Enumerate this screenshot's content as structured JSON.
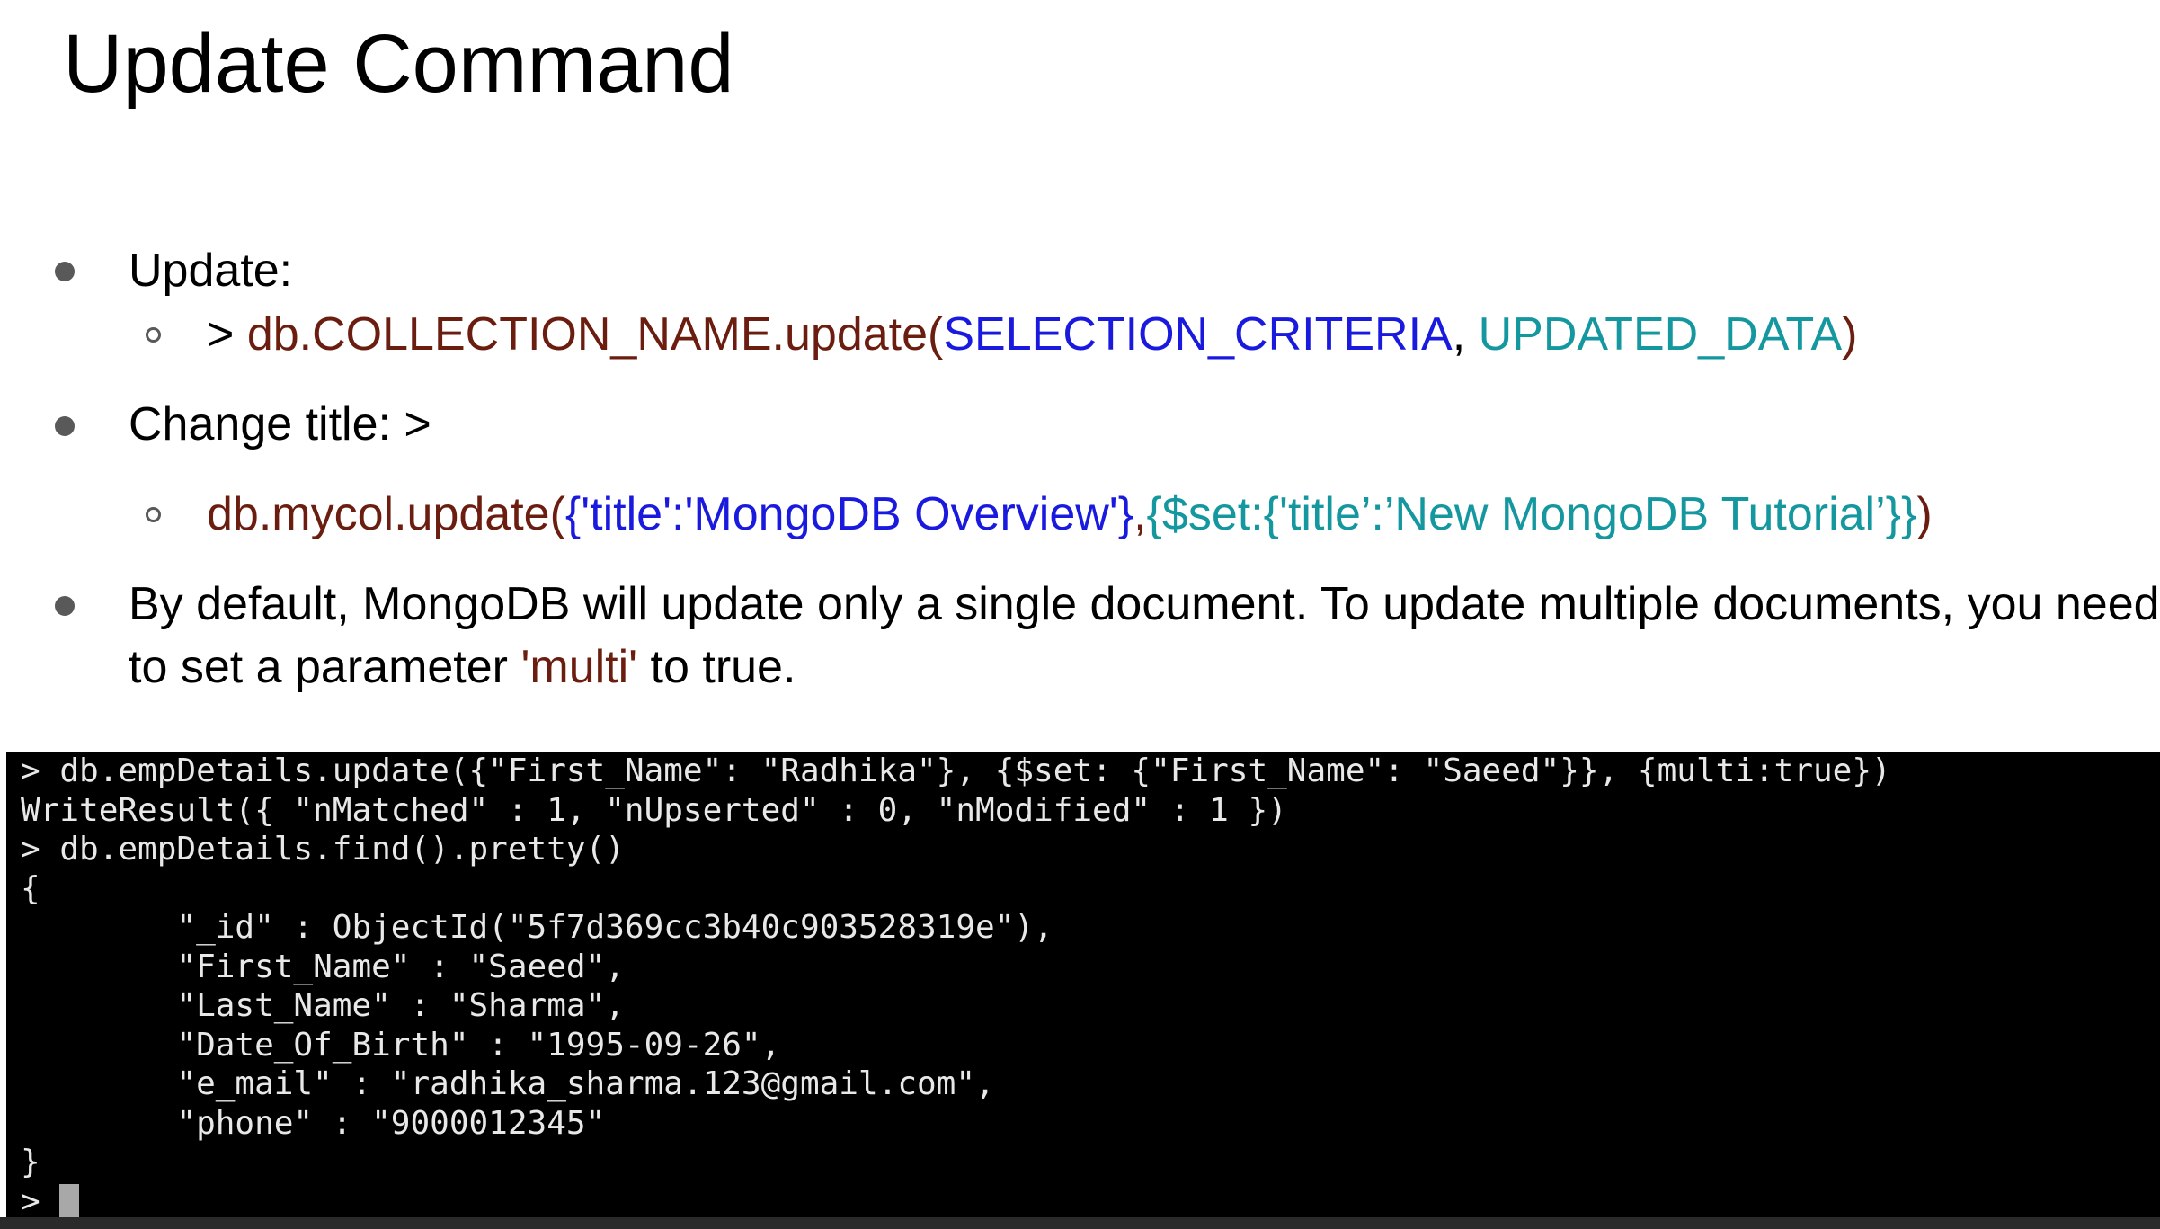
{
  "slide": {
    "title": "Update Command",
    "bullets": [
      {
        "label": "Update:"
      },
      {
        "label": "Change title: >"
      },
      {
        "text_plain_a": "By default, MongoDB will update only a single document. To update multiple documents, you need",
        "text_plain_b": "to set a parameter ",
        "text_highlight": "'multi'",
        "text_plain_c": " to true."
      }
    ],
    "sub_bullets": [
      {
        "prompt": "> ",
        "method": "db.COLLECTION_NAME.update(",
        "criteria": "SELECTION_CRITERIA",
        "comma": ", ",
        "data": "UPDATED_DATA",
        "close": ")"
      },
      {
        "method": "db.mycol.update(",
        "criteria": "{'title':'MongoDB Overview'}",
        "comma": ",",
        "data": "{$set:{'title’:’New MongoDB Tutorial’}}",
        "close": ")"
      }
    ]
  },
  "terminal": {
    "lines": [
      "> db.empDetails.update({\"First_Name\": \"Radhika\"}, {$set: {\"First_Name\": \"Saeed\"}}, {multi:true})",
      "WriteResult({ \"nMatched\" : 1, \"nUpserted\" : 0, \"nModified\" : 1 })",
      "> db.empDetails.find().pretty()",
      "{",
      "        \"_id\" : ObjectId(\"5f7d369cc3b40c903528319e\"),",
      "        \"First_Name\" : \"Saeed\",",
      "        \"Last_Name\" : \"Sharma\",",
      "        \"Date_Of_Birth\" : \"1995-09-26\",",
      "        \"e_mail\" : \"radhika_sharma.123@gmail.com\",",
      "        \"phone\" : \"9000012345\"",
      "}"
    ],
    "prompt": "> "
  },
  "colors": {
    "method": "#6b1d10",
    "criteria": "#1a1adf",
    "data": "#15979f",
    "terminal_bg": "#000000",
    "terminal_fg": "#e8e8e8"
  }
}
